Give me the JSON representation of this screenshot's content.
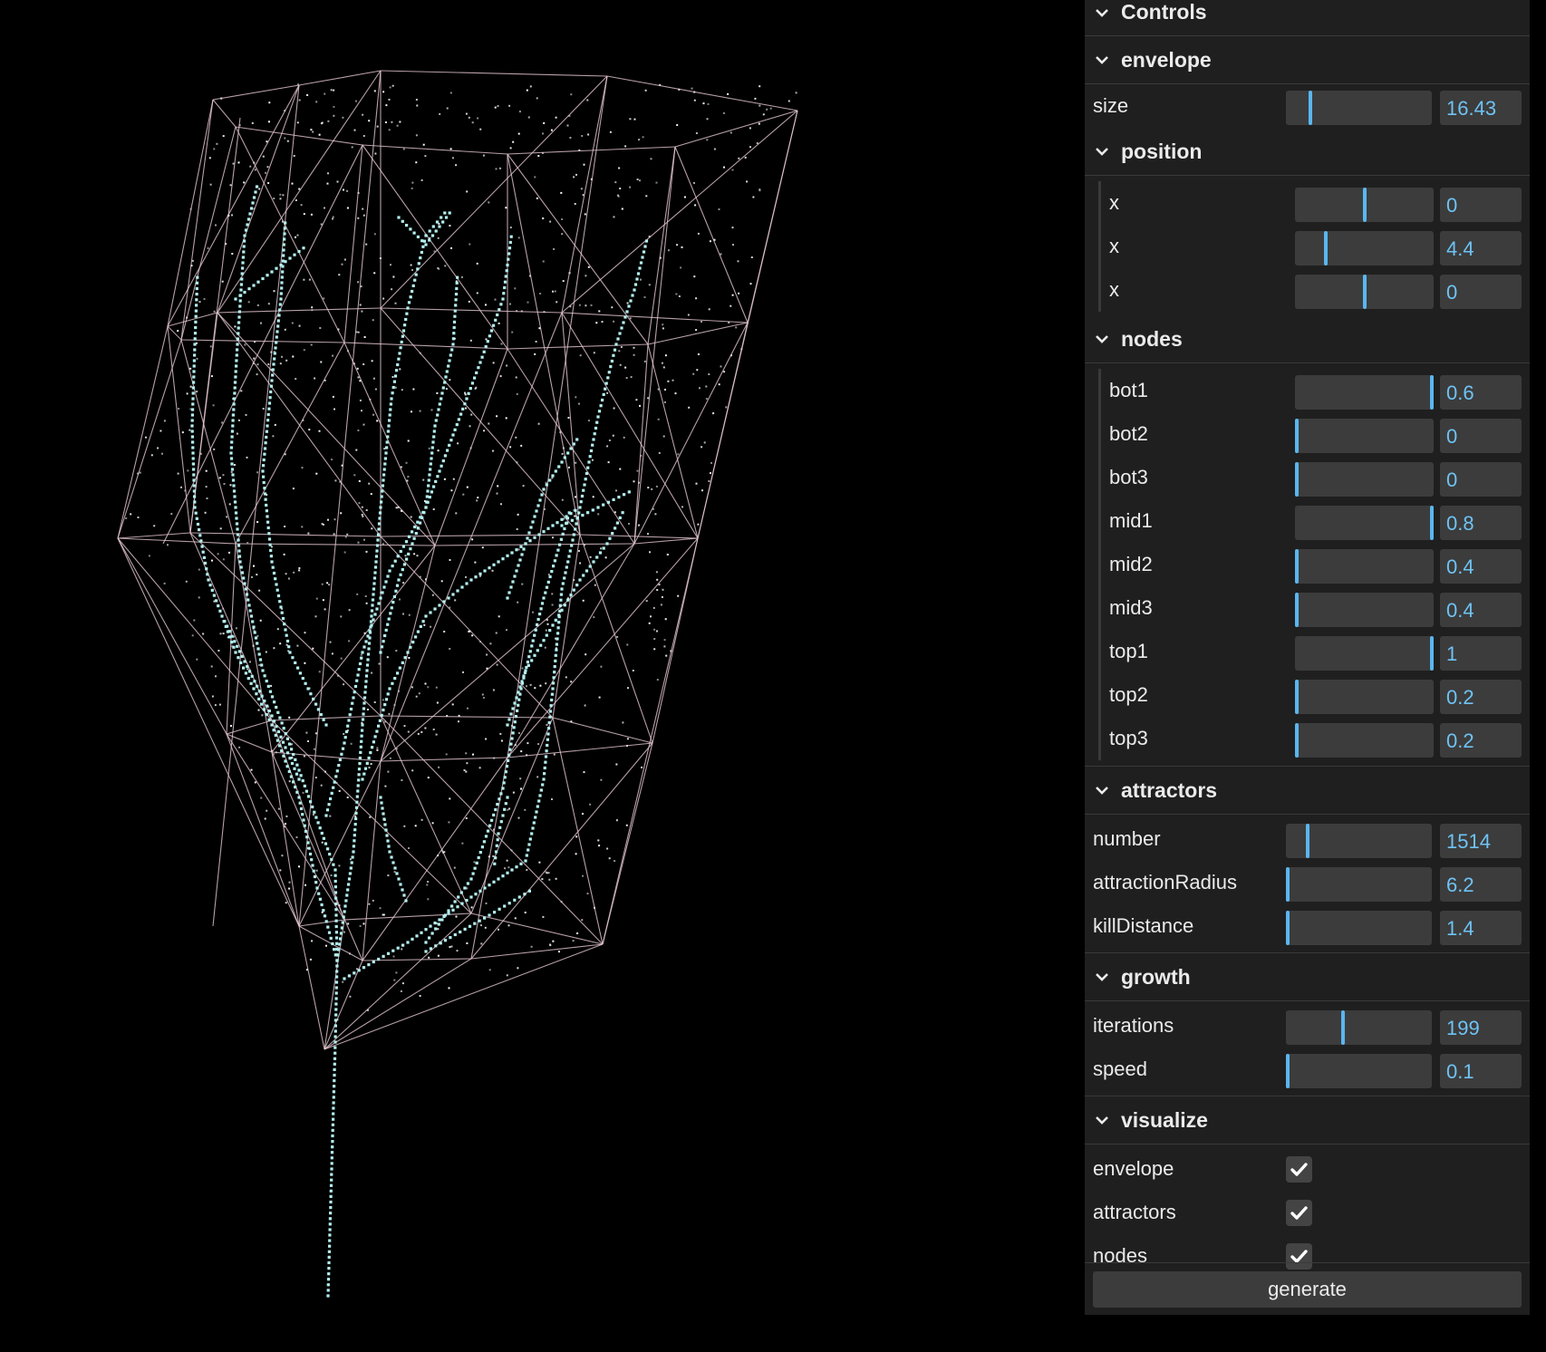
{
  "gui": {
    "title": "Controls",
    "envelope": {
      "title": "envelope",
      "size": {
        "label": "size",
        "value": "16.43",
        "fraction": 0.17
      }
    },
    "position": {
      "title": "position",
      "items": [
        {
          "label": "x",
          "value": "0",
          "fraction": 0.5
        },
        {
          "label": "x",
          "value": "4.4",
          "fraction": 0.22
        },
        {
          "label": "x",
          "value": "0",
          "fraction": 0.5
        }
      ]
    },
    "nodes": {
      "title": "nodes",
      "items": [
        {
          "label": "bot1",
          "value": "0.6",
          "fraction": 1.0
        },
        {
          "label": "bot2",
          "value": "0",
          "fraction": 0.0
        },
        {
          "label": "bot3",
          "value": "0",
          "fraction": 0.0
        },
        {
          "label": "mid1",
          "value": "0.8",
          "fraction": 1.0
        },
        {
          "label": "mid2",
          "value": "0.4",
          "fraction": 0.0
        },
        {
          "label": "mid3",
          "value": "0.4",
          "fraction": 0.0
        },
        {
          "label": "top1",
          "value": "1",
          "fraction": 1.0
        },
        {
          "label": "top2",
          "value": "0.2",
          "fraction": 0.0
        },
        {
          "label": "top3",
          "value": "0.2",
          "fraction": 0.0
        }
      ]
    },
    "attractors": {
      "title": "attractors",
      "items": [
        {
          "label": "number",
          "value": "1514",
          "fraction": 0.15
        },
        {
          "label": "attractionRadius",
          "value": "6.2",
          "fraction": 0.0
        },
        {
          "label": "killDistance",
          "value": "1.4",
          "fraction": 0.0
        }
      ]
    },
    "growth": {
      "title": "growth",
      "items": [
        {
          "label": "iterations",
          "value": "199",
          "fraction": 0.39
        },
        {
          "label": "speed",
          "value": "0.1",
          "fraction": 0.0
        }
      ]
    },
    "visualize": {
      "title": "visualize",
      "items": [
        {
          "label": "envelope",
          "checked": true
        },
        {
          "label": "attractors",
          "checked": true
        },
        {
          "label": "nodes",
          "checked": true
        }
      ]
    },
    "generate_label": "generate"
  },
  "colors": {
    "background": "#000000",
    "envelope_wire": "#e6c8d2",
    "attractor_points": "#ffffff",
    "node_points": "#b4f0f0",
    "panel": "#1f1f1f",
    "slider_track": "#3c3c3c",
    "accent": "#5ab6f0"
  }
}
